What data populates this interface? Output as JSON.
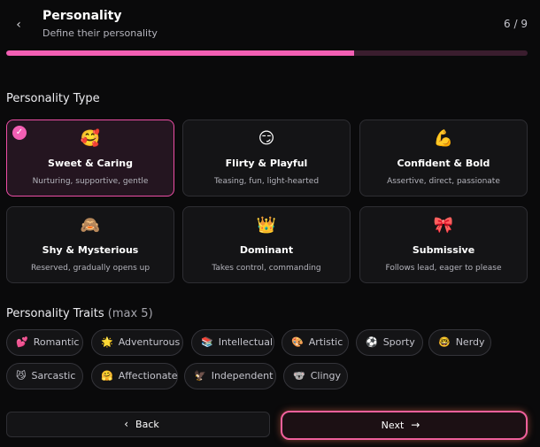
{
  "header": {
    "title": "Personality",
    "subtitle": "Define their personality",
    "step": "6 / 9",
    "back_icon": "chevron-left-icon"
  },
  "progress": {
    "fraction": 0.667,
    "color": "#f35fb4"
  },
  "personality_type": {
    "label": "Personality Type",
    "options": [
      {
        "emoji": "🥰",
        "title": "Sweet & Caring",
        "desc": "Nurturing, supportive, gentle",
        "selected": true
      },
      {
        "emoji": "😏",
        "title": "Flirty & Playful",
        "desc": "Teasing, fun, light-hearted",
        "selected": false
      },
      {
        "emoji": "💪",
        "title": "Confident & Bold",
        "desc": "Assertive, direct, passionate",
        "selected": false
      },
      {
        "emoji": "🙈",
        "title": "Shy & Mysterious",
        "desc": "Reserved, gradually opens up",
        "selected": false
      },
      {
        "emoji": "👑",
        "title": "Dominant",
        "desc": "Takes control, commanding",
        "selected": false
      },
      {
        "emoji": "🎀",
        "title": "Submissive",
        "desc": "Follows lead, eager to please",
        "selected": false
      }
    ]
  },
  "personality_traits": {
    "label": "Personality Traits",
    "note": "(max 5)",
    "chips": [
      {
        "emoji": "💕",
        "label": "Romantic"
      },
      {
        "emoji": "🌟",
        "label": "Adventurous"
      },
      {
        "emoji": "📚",
        "label": "Intellectual"
      },
      {
        "emoji": "🎨",
        "label": "Artistic"
      },
      {
        "emoji": "⚽",
        "label": "Sporty"
      },
      {
        "emoji": "🤓",
        "label": "Nerdy"
      },
      {
        "emoji": "😼",
        "label": "Sarcastic"
      },
      {
        "emoji": "🤗",
        "label": "Affectionate"
      },
      {
        "emoji": "🦅",
        "label": "Independent"
      },
      {
        "emoji": "🐨",
        "label": "Clingy"
      }
    ]
  },
  "footer": {
    "back_label": "Back",
    "back_icon": "chevron-left-icon",
    "next_label": "Next",
    "next_icon": "arrow-right-icon"
  },
  "colors": {
    "accent": "#f35fb4",
    "background": "#0a0a0b",
    "card": "#141416"
  }
}
